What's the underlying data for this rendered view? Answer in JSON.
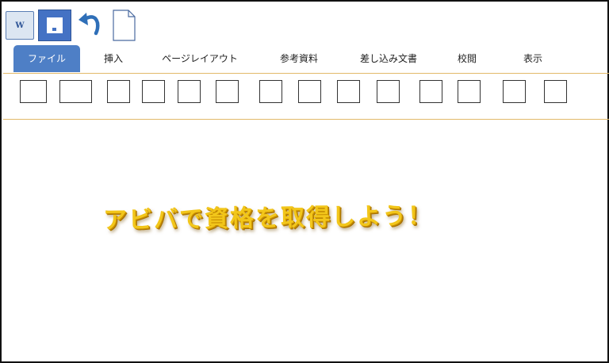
{
  "quick_access": {
    "word_icon_label": "W",
    "save_icon": "save-icon",
    "undo_icon": "undo-icon",
    "new_document_icon": "document-icon"
  },
  "tabs": [
    {
      "label": "ファイル",
      "active": true
    },
    {
      "label": "挿入",
      "active": false
    },
    {
      "label": "ページレイアウト",
      "active": false
    },
    {
      "label": "参考資料",
      "active": false
    },
    {
      "label": "差し込み文書",
      "active": false
    },
    {
      "label": "校閲",
      "active": false
    },
    {
      "label": "表示",
      "active": false
    }
  ],
  "ribbon": {
    "button_count": 14
  },
  "document": {
    "headline": "アビバで資格を取得しよう！"
  },
  "colors": {
    "accent_blue": "#4e7fc6",
    "divider": "#e2b969",
    "headline_gold": "#f2c61a"
  }
}
